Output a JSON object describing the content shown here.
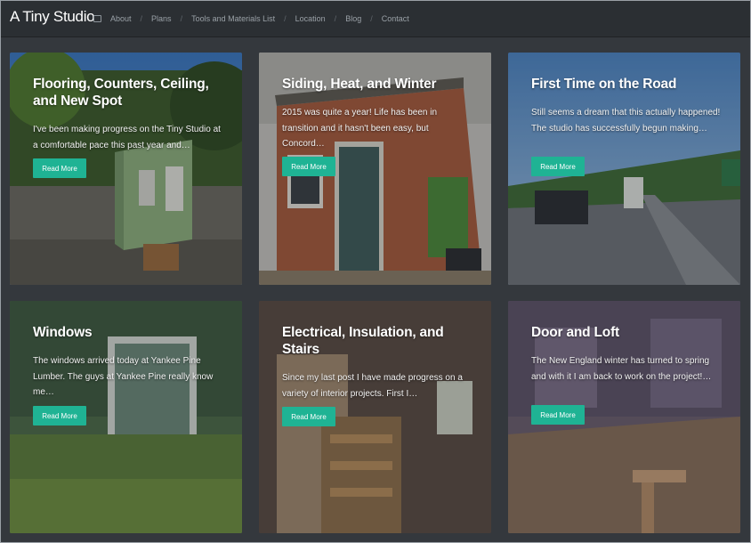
{
  "site": {
    "title": "A Tiny Studio"
  },
  "nav": [
    "About",
    "Plans",
    "Tools and Materials List",
    "Location",
    "Blog",
    "Contact"
  ],
  "read_more": "Read More",
  "posts": [
    {
      "title": "Flooring, Counters, Ceiling, and New Spot",
      "excerpt": "I've been making progress on the Tiny Studio at a comfortable pace this past year and…"
    },
    {
      "title": "Siding, Heat, and Winter",
      "excerpt": "2015 was quite a year! Life has been in transition and it hasn't been easy, but Concord…"
    },
    {
      "title": "First Time on the Road",
      "excerpt": "Still seems a dream that this actually happened! The studio has successfully begun making…"
    },
    {
      "title": "Windows",
      "excerpt": "The windows arrived today at Yankee Pine Lumber. The guys at Yankee Pine really know me…"
    },
    {
      "title": "Electrical, Insulation, and Stairs",
      "excerpt": "Since my last post I have made progress on a variety of interior projects. First I…"
    },
    {
      "title": "Door and Loft",
      "excerpt": "The New England winter has turned to spring and with it I am back to work on the project!…"
    }
  ],
  "colors": {
    "accent": "#1fb394",
    "background": "#34383d",
    "topbar": "#2b2f33"
  }
}
